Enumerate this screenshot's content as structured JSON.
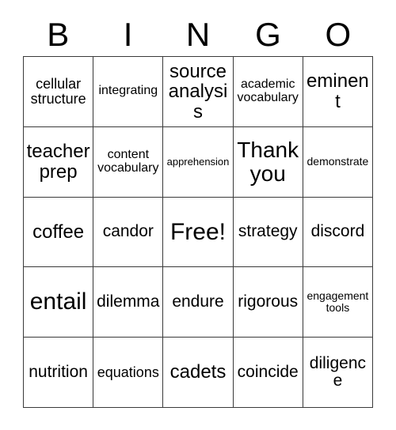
{
  "card": {
    "header_letters": [
      "B",
      "I",
      "N",
      "G",
      "O"
    ],
    "rows": [
      [
        {
          "text": "cellular structure",
          "size": "sm"
        },
        {
          "text": "integrating",
          "size": "xs"
        },
        {
          "text": "source analysis",
          "size": "lg"
        },
        {
          "text": "academic vocabulary",
          "size": "xs"
        },
        {
          "text": "eminent",
          "size": "lg"
        }
      ],
      [
        {
          "text": "teacher prep",
          "size": "lg"
        },
        {
          "text": "content vocabulary",
          "size": "xs"
        },
        {
          "text": "apprehension",
          "size": "tiny"
        },
        {
          "text": "Thank you",
          "size": "xl"
        },
        {
          "text": "demonstrate",
          "size": "xxs"
        }
      ],
      [
        {
          "text": "coffee",
          "size": "lg"
        },
        {
          "text": "candor",
          "size": "md"
        },
        {
          "text": "Free!",
          "size": "xxl"
        },
        {
          "text": "strategy",
          "size": "md"
        },
        {
          "text": "discord",
          "size": "md"
        }
      ],
      [
        {
          "text": "entail",
          "size": "xxl"
        },
        {
          "text": "dilemma",
          "size": "md"
        },
        {
          "text": "endure",
          "size": "md"
        },
        {
          "text": "rigorous",
          "size": "md"
        },
        {
          "text": "engagement tools",
          "size": "xxs"
        }
      ],
      [
        {
          "text": "nutrition",
          "size": "md"
        },
        {
          "text": "equations",
          "size": "sm"
        },
        {
          "text": "cadets",
          "size": "lg"
        },
        {
          "text": "coincide",
          "size": "md"
        },
        {
          "text": "diligence",
          "size": "md"
        }
      ]
    ],
    "free_space": {
      "row": 2,
      "column": 2,
      "label": "Free!"
    },
    "colors": {
      "background": "#ffffff",
      "border": "#3a3a3a",
      "text": "#000000"
    }
  }
}
